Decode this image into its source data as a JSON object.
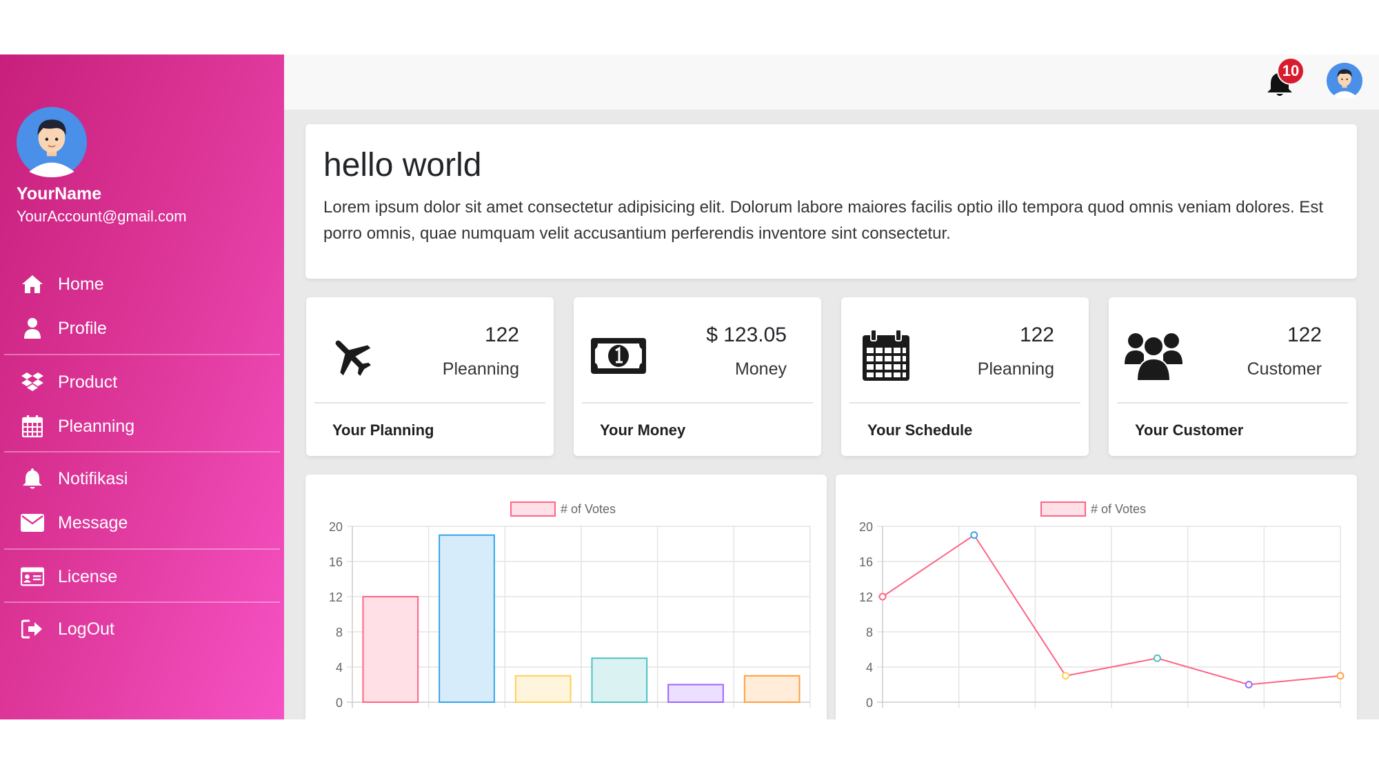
{
  "user": {
    "name": "YourName",
    "email": "YourAccount@gmail.com"
  },
  "nav": {
    "home": "Home",
    "profile": "Profile",
    "product": "Product",
    "planning": "Pleanning",
    "notifications": "Notifikasi",
    "message": "Message",
    "license": "License",
    "logout": "LogOut"
  },
  "topbar": {
    "notification_count": "10"
  },
  "hero": {
    "title": "hello world",
    "text": "Lorem ipsum dolor sit amet consectetur adipisicing elit. Dolorum labore maiores facilis optio illo tempora quod omnis veniam dolores. Est porro omnis, quae numquam velit accusantium perferendis inventore sint consectetur."
  },
  "stats": [
    {
      "value": "122",
      "label": "Pleanning",
      "footer": "Your Planning",
      "icon": "airplane-icon"
    },
    {
      "value": "$ 123.05",
      "label": "Money",
      "footer": "Your Money",
      "icon": "money-bill-icon"
    },
    {
      "value": "122",
      "label": "Pleanning",
      "footer": "Your Schedule",
      "icon": "calendar-icon"
    },
    {
      "value": "122",
      "label": "Customer",
      "footer": "Your Customer",
      "icon": "users-icon"
    }
  ],
  "colors": {
    "sidebar_start": "#c71f7b",
    "sidebar_end": "#f652c4",
    "badge": "#d81b2e"
  },
  "chart_data": [
    {
      "type": "bar",
      "legend": "# of Votes",
      "values": [
        12,
        19,
        3,
        5,
        2,
        3
      ],
      "ylim": [
        0,
        20
      ],
      "yticks": [
        0,
        4,
        8,
        12,
        16,
        20
      ],
      "colors": {
        "fill": [
          "#ffe0e6",
          "#d7ecfb",
          "#fff5dd",
          "#dbf2f2",
          "#ebe0ff",
          "#ffecd9"
        ],
        "stroke": [
          "#ff6384",
          "#36a2eb",
          "#ffce56",
          "#4bc0c0",
          "#9966ff",
          "#ff9f40"
        ]
      }
    },
    {
      "type": "line",
      "legend": "# of Votes",
      "values": [
        12,
        19,
        3,
        5,
        2,
        3
      ],
      "ylim": [
        0,
        20
      ],
      "yticks": [
        0,
        4,
        8,
        12,
        16,
        20
      ],
      "colors": {
        "line": "#ff6384",
        "points": [
          "#ff6384",
          "#36a2eb",
          "#ffce56",
          "#4bc0c0",
          "#9966ff",
          "#ff9f40"
        ]
      }
    }
  ]
}
